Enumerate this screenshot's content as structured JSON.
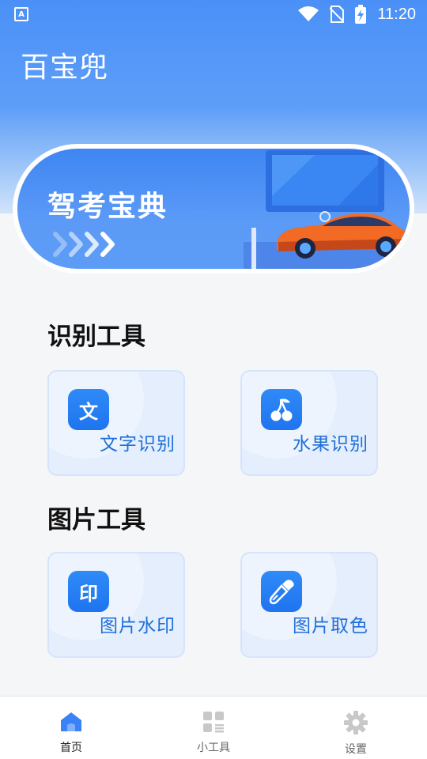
{
  "status_bar": {
    "time": "11:20",
    "left_icon": "notification-a-icon",
    "icons": [
      "wifi-icon",
      "no-sim-icon",
      "battery-charging-icon"
    ]
  },
  "app": {
    "title": "百宝兜"
  },
  "banner": {
    "title": "驾考宝典"
  },
  "sections": [
    {
      "title": "识别工具",
      "cards": [
        {
          "label": "文字识别",
          "icon": "text-recognition-icon",
          "glyph": "文"
        },
        {
          "label": "水果识别",
          "icon": "cherry-icon",
          "glyph": ""
        }
      ]
    },
    {
      "title": "图片工具",
      "cards": [
        {
          "label": "图片水印",
          "icon": "stamp-icon",
          "glyph": "印"
        },
        {
          "label": "图片取色",
          "icon": "eyedropper-icon",
          "glyph": ""
        }
      ]
    }
  ],
  "nav": {
    "items": [
      {
        "label": "首页",
        "icon": "home-icon",
        "active": true
      },
      {
        "label": "小工具",
        "icon": "grid-tools-icon",
        "active": false
      },
      {
        "label": "设置",
        "icon": "gear-icon",
        "active": false
      }
    ]
  },
  "colors": {
    "brand": "#4a90f7",
    "icon_bg": "#1f74ef",
    "card_bg": "#e4eefd",
    "card_label": "#1f6fd8",
    "nav_active": "#3b82f6",
    "nav_inactive": "#c8c8c8"
  }
}
